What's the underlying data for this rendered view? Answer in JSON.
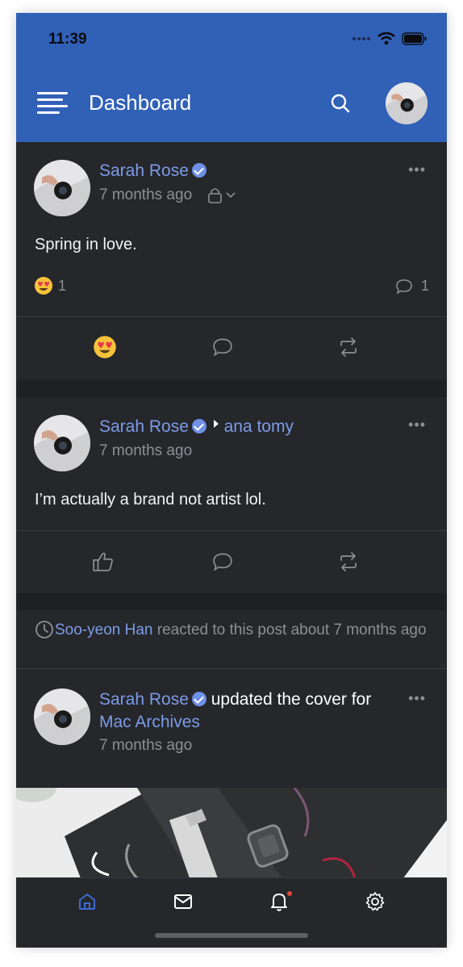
{
  "status_bar": {
    "time": "11:39"
  },
  "header": {
    "title": "Dashboard"
  },
  "posts": [
    {
      "author": "Sarah Rose",
      "time": "7 months ago",
      "text": "Spring in love.",
      "reaction_count": "1",
      "comment_count": "1"
    },
    {
      "author": "Sarah Rose",
      "recipient": "ana tomy",
      "time": "7 months ago",
      "text": "I’m actually a brand not artist lol."
    },
    {
      "author": "Sarah Rose",
      "action_text": "updated the cover for",
      "target": "Mac Archives",
      "time": "7 months ago"
    }
  ],
  "activity": {
    "user": "Soo-yeon Han",
    "text": "reacted to this post about 7 months ago"
  },
  "more_menu": "•••",
  "colors": {
    "header_bg": "#3160b7",
    "card_bg": "#25272b",
    "link": "#7d9be8",
    "muted": "#8c8f94",
    "notification_dot": "#e04b3b"
  },
  "icons": [
    "hamburger-menu-icon",
    "search-icon",
    "verified-badge-icon",
    "lock-icon",
    "chevron-down-icon",
    "heart-eyes-emoji-icon",
    "comment-icon",
    "repost-icon",
    "thumbs-up-icon",
    "clock-icon",
    "home-icon",
    "mail-icon",
    "bell-icon",
    "gear-icon",
    "triangle-right-icon"
  ]
}
